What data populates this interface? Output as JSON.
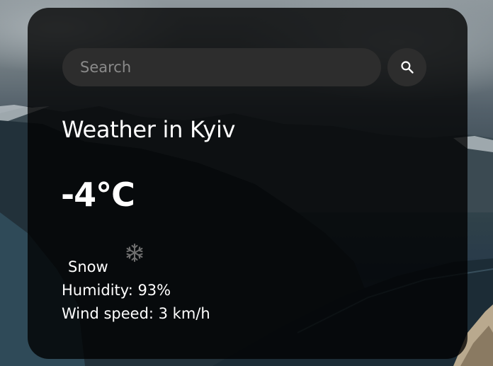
{
  "search": {
    "placeholder": "Search",
    "value": "",
    "button_icon": "search-icon"
  },
  "weather": {
    "title": "Weather in Kyiv",
    "temperature": "-4°C",
    "condition_icon": "snowflake-icon",
    "description": "Snow",
    "humidity": "Humidity: 93%",
    "wind": "Wind speed: 3 km/h"
  },
  "colors": {
    "card_background": "#000000",
    "input_background": "#2d2d2d",
    "text": "#ffffff",
    "placeholder": "#8a8a8a"
  }
}
